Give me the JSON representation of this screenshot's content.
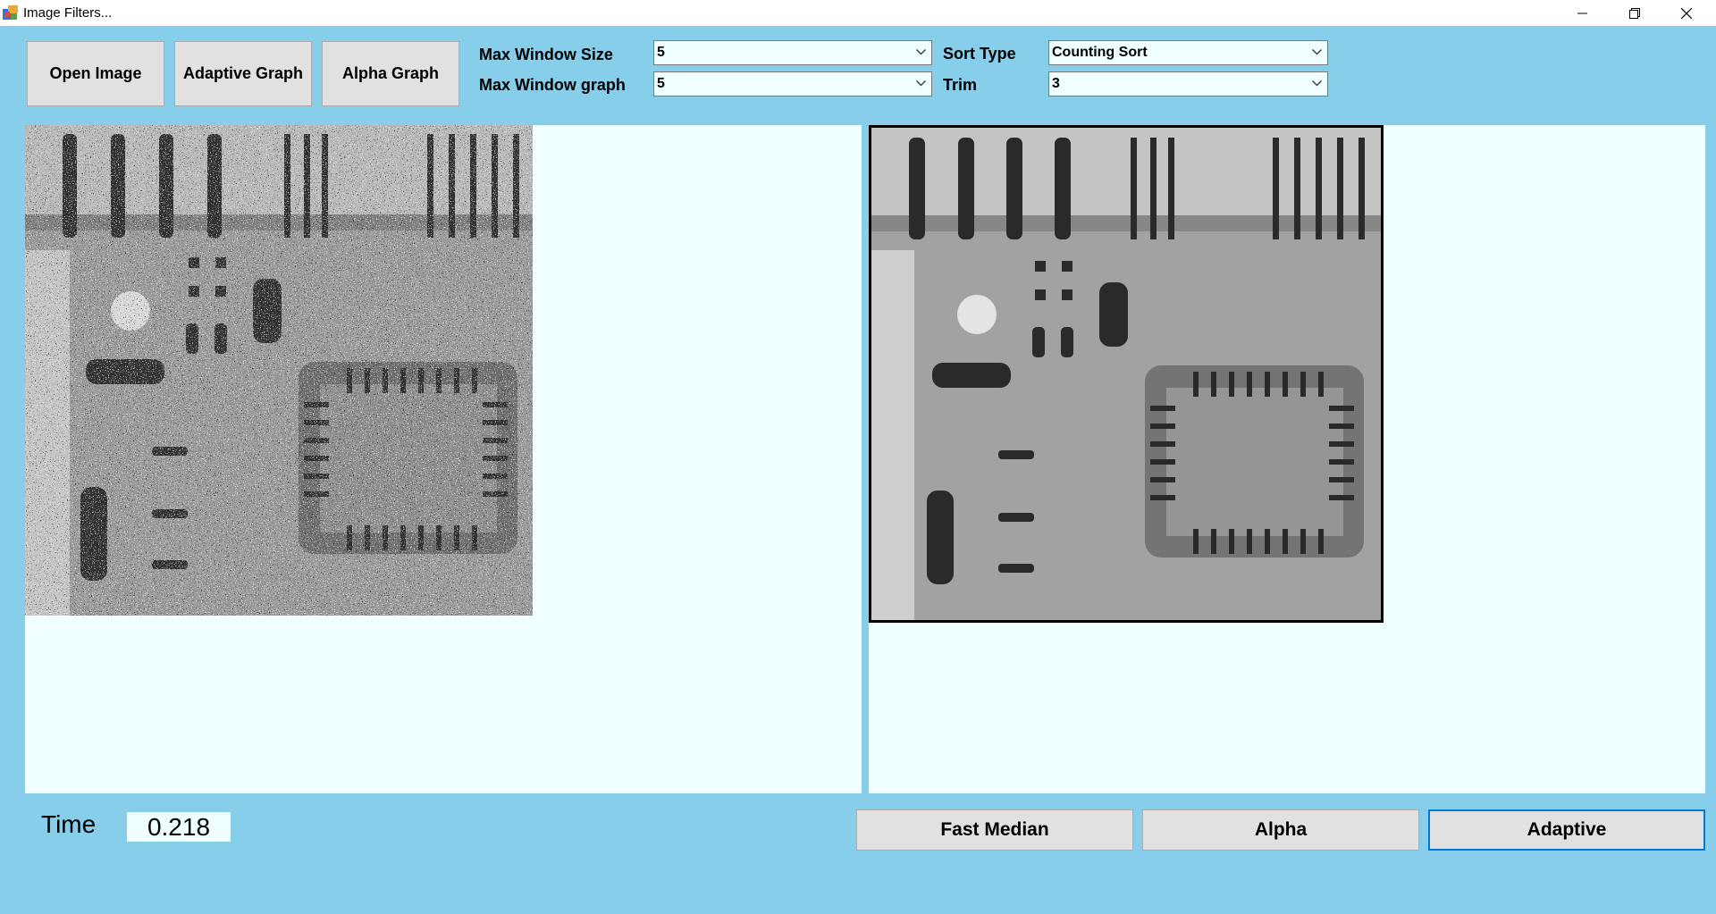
{
  "window": {
    "title": "Image Filters..."
  },
  "toolbar": {
    "open_image": "Open Image",
    "adaptive_graph": "Adaptive Graph",
    "alpha_graph": "Alpha Graph"
  },
  "settings": {
    "max_window_size_label": "Max Window Size",
    "max_window_size_value": "5",
    "max_window_graph_label": "Max Window graph",
    "max_window_graph_value": "5",
    "sort_type_label": "Sort Type",
    "sort_type_value": "Counting Sort",
    "trim_label": "Trim",
    "trim_value": "3"
  },
  "status": {
    "time_label": "Time",
    "time_value": "0.218"
  },
  "filters": {
    "fast_median": "Fast Median",
    "alpha": "Alpha",
    "adaptive": "Adaptive"
  },
  "colors": {
    "background": "#87ceeb",
    "panel": "#f0ffff",
    "button": "#e1e1e1",
    "focus": "#0078d7"
  }
}
